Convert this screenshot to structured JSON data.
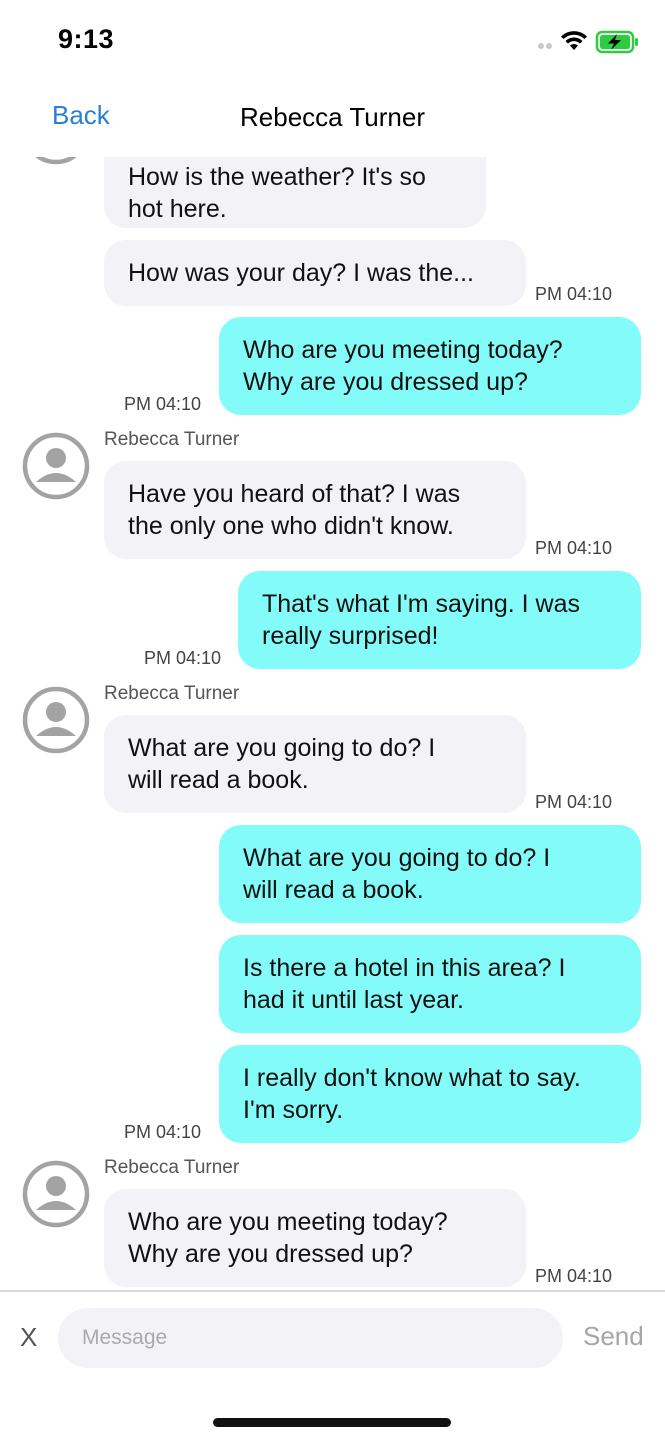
{
  "status_bar": {
    "time": "9:13"
  },
  "nav": {
    "back_label": "Back",
    "title": "Rebecca Turner"
  },
  "chat": {
    "sender_name": "Rebecca Turner",
    "messages": [
      {
        "lines": [
          "How is the weather? It's so",
          "hot here."
        ]
      },
      {
        "lines": [
          "How was your day? I was the..."
        ],
        "time": "PM 04:10"
      },
      {
        "lines": [
          "Who are you meeting today?",
          "Why are you dressed up?"
        ],
        "time": "PM 04:10"
      },
      {
        "lines": [
          "Have you heard of that? I was",
          "the only one who didn't know."
        ],
        "time": "PM 04:10"
      },
      {
        "lines": [
          "That's what I'm saying. I was",
          "really surprised!"
        ],
        "time": "PM 04:10"
      },
      {
        "lines": [
          "What are you going to do? I",
          "will read a book."
        ],
        "time": "PM 04:10"
      },
      {
        "lines": [
          "What are you going to do? I",
          "will read a book."
        ]
      },
      {
        "lines": [
          "Is there a hotel in this area? I",
          "had it until last year."
        ]
      },
      {
        "lines": [
          "I really don't know what to say.",
          "I'm sorry."
        ],
        "time": "PM 04:10"
      },
      {
        "lines": [
          "Who are you meeting today?",
          "Why are you dressed up?"
        ],
        "time": "PM 04:10"
      }
    ]
  },
  "composer": {
    "cancel_label": "X",
    "placeholder": "Message",
    "send_label": "Send"
  },
  "icons": [
    "wifi-icon",
    "battery-charging-icon",
    "signal-icon",
    "avatar-placeholder-icon"
  ],
  "colors": {
    "accent": "#2a7fd4",
    "incoming_bubble": "#f2f2f7",
    "outgoing_bubble": "#83fbf8"
  }
}
